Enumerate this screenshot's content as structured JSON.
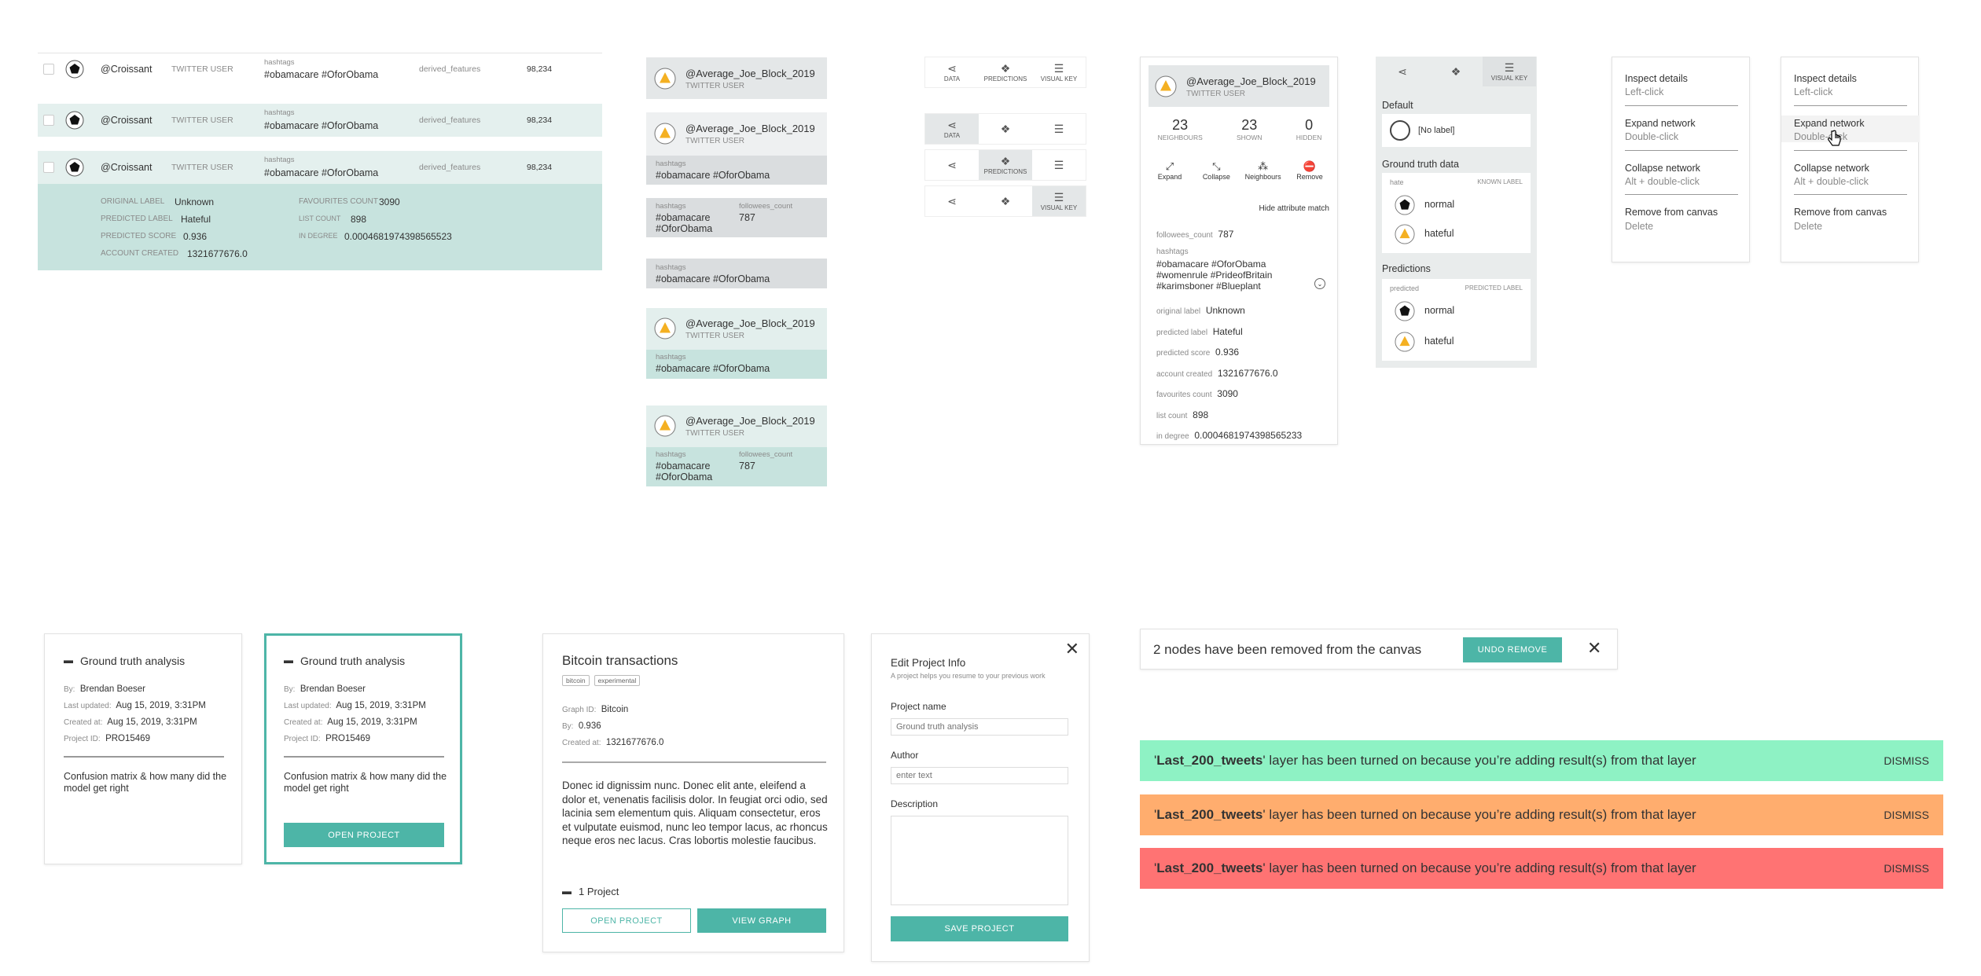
{
  "table": {
    "handle": "@Croissant",
    "user_type": "TWITTER USER",
    "hashtags_label": "hashtags",
    "hashtags": "#obamacare #OforObama",
    "derived": "derived_features",
    "value": "98,234",
    "details": {
      "original_label_k": "ORIGINAL LABEL",
      "original_label_v": "Unknown",
      "predicted_label_k": "PREDICTED LABEL",
      "predicted_label_v": "Hateful",
      "predicted_score_k": "PREDICTED SCORE",
      "predicted_score_v": "0.936",
      "account_created_k": "ACCOUNT CREATED",
      "account_created_v": "1321677676.0",
      "fav_k": "FAVOURITES COUNT",
      "fav_v": "3090",
      "list_k": "LIST COUNT",
      "list_v": "898",
      "indeg_k": "IN DEGREE",
      "indeg_v": "0.0004681974398565523"
    }
  },
  "nodecards": {
    "name": "@Average_Joe_Block_2019",
    "type": "TWITTER USER",
    "hashtags_label": "hashtags",
    "hashtags": "#obamacare #OforObama",
    "hashtags_a": "#obamacare",
    "hashtags_b": "#OforObama",
    "followees_label": "followees_count",
    "followees": "787"
  },
  "toolbar": {
    "data": "DATA",
    "predictions": "PREDICTIONS",
    "visual_key": "VISUAL KEY"
  },
  "inspect": {
    "name": "@Average_Joe_Block_2019",
    "type": "TWITTER USER",
    "neighbours_n": "23",
    "neighbours_l": "NEIGHBOURS",
    "shown_n": "23",
    "shown_l": "SHOWN",
    "hidden_n": "0",
    "hidden_l": "HIDDEN",
    "expand": "Expand",
    "collapse": "Collapse",
    "neighbours": "Neighbours",
    "remove": "Remove",
    "hide_attr": "Hide attribute match",
    "followees_k": "followees_count",
    "followees_v": "787",
    "hashtags_k": "hashtags",
    "hashtags_1": "#obamacare #OforObama",
    "hashtags_2": "#womenrule #PrideofBritain",
    "hashtags_3": "#karimsboner #Blueplant",
    "original_k": "original label",
    "original_v": "Unknown",
    "predicted_k": "predicted label",
    "predicted_v": "Hateful",
    "score_k": "predicted score",
    "score_v": "0.936",
    "created_k": "account created",
    "created_v": "1321677676.0",
    "fav_k": "favourites count",
    "fav_v": "3090",
    "list_k": "list count",
    "list_v": "898",
    "indeg_k": "in degree",
    "indeg_v": "0.0004681974398565233"
  },
  "visualkey": {
    "visual_key": "VISUAL KEY",
    "default": "Default",
    "no_label": "[No label]",
    "gt": "Ground truth data",
    "hate": "hate",
    "known": "KNOWN LABEL",
    "normal": "normal",
    "hateful": "hateful",
    "predictions": "Predictions",
    "predicted": "predicted",
    "pred_label": "PREDICTED LABEL"
  },
  "menu": {
    "inspect": "Inspect details",
    "inspect_s": "Left-click",
    "expand": "Expand network",
    "expand_s": "Double-click",
    "collapse": "Collapse network",
    "collapse_s": "Alt + double-click",
    "remove": "Remove from canvas",
    "remove_s": "Delete"
  },
  "project": {
    "title": "Ground truth analysis",
    "by_k": "By:",
    "by_v": "Brendan Boeser",
    "upd_k": "Last updated:",
    "upd_v": "Aug 15, 2019, 3:31PM",
    "cre_k": "Created at:",
    "cre_v": "Aug 15, 2019, 3:31PM",
    "id_k": "Project ID:",
    "id_v": "PRO15469",
    "desc": "Confusion matrix & how many did the model get right",
    "open": "OPEN PROJECT"
  },
  "graph": {
    "title": "Bitcoin transactions",
    "tag1": "bitcoin",
    "tag2": "experimental",
    "gid_k": "Graph ID:",
    "gid_v": "Bitcoin",
    "by_k": "By:",
    "by_v": "0.936",
    "cre_k": "Created at:",
    "cre_v": "1321677676.0",
    "body": "Donec id dignissim nunc. Donec elit ante, eleifend a dolor et, venenatis facilisis dolor. In feugiat orci odio, sed lacinia sem elementum quis. Aliquam consectetur, eros et vulputate euismod, nunc leo tempor lacus, ac rhoncus neque eros nec lacus. Cras lobortis molestie faucibus.",
    "projects": "1 Project",
    "open": "OPEN PROJECT",
    "view": "VIEW GRAPH"
  },
  "edit": {
    "title": "Edit Project Info",
    "sub": "A project helps you resume to your previous work",
    "name_l": "Project name",
    "name_ph": "Ground truth analysis",
    "author_l": "Author",
    "author_ph": "enter text",
    "desc_l": "Description",
    "save": "SAVE PROJECT"
  },
  "toast": {
    "msg": "2 nodes have been removed from the canvas",
    "undo": "UNDO REMOVE"
  },
  "notifs": {
    "layer": "Last_200_tweets",
    "text": "layer has been turned on because you’re adding result(s) from that layer",
    "dismiss": "DISMISS",
    "colors": [
      "#8ef2c4",
      "#ffad6e",
      "#ff7373"
    ]
  }
}
